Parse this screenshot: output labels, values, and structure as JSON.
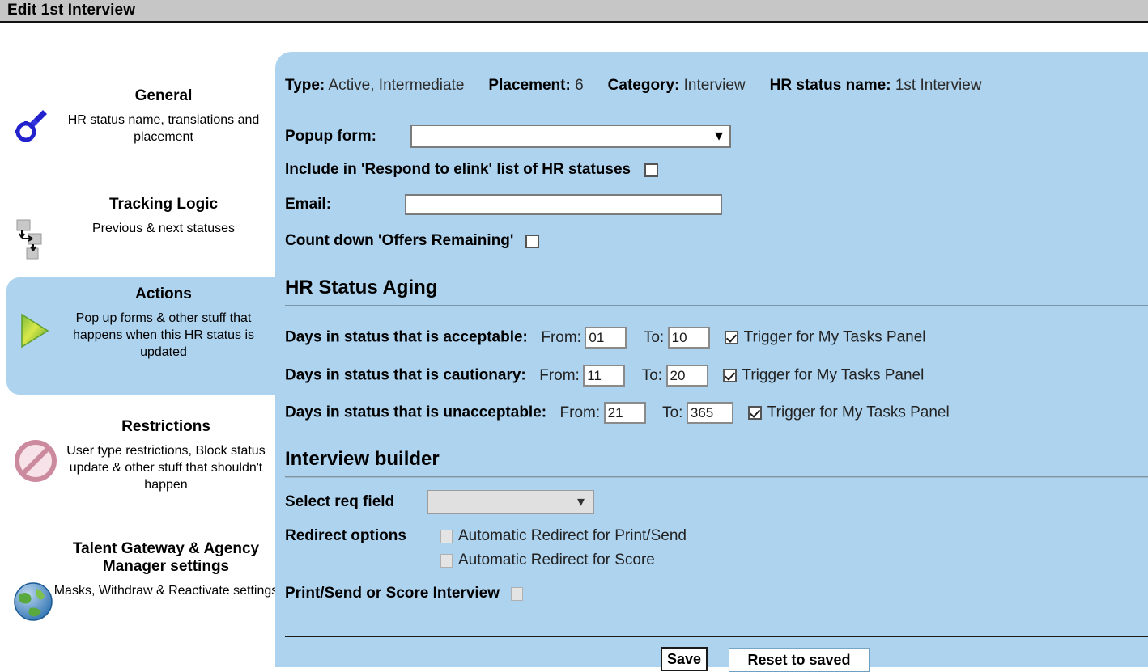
{
  "window": {
    "title": "Edit 1st Interview"
  },
  "sidebar": {
    "items": [
      {
        "key": "general",
        "icon": "wrench-gear-icon",
        "title": "General",
        "desc": "HR status name, translations and placement",
        "selected": false
      },
      {
        "key": "tracking-logic",
        "icon": "flowchart-icon",
        "title": "Tracking Logic",
        "desc": "Previous & next statuses",
        "selected": false
      },
      {
        "key": "actions",
        "icon": "green-play-arrow-icon",
        "title": "Actions",
        "desc": "Pop up forms & other stuff that happens when this HR status is updated",
        "selected": true
      },
      {
        "key": "restrictions",
        "icon": "no-entry-icon",
        "title": "Restrictions",
        "desc": "User type restrictions, Block status update & other stuff that shouldn't happen",
        "selected": false
      },
      {
        "key": "talent-gateway",
        "icon": "globe-icon",
        "title": "Talent Gateway & Agency Manager settings",
        "desc": "Masks, Withdraw & Reactivate settings",
        "selected": false
      }
    ]
  },
  "summary": {
    "type_label": "Type:",
    "type_value": "Active, Intermediate",
    "placement_label": "Placement:",
    "placement_value": "6",
    "category_label": "Category:",
    "category_value": "Interview",
    "hr_status_name_label": "HR status name:",
    "hr_status_name_value": "1st Interview"
  },
  "form": {
    "popup_form_label": "Popup form:",
    "popup_form_value": "",
    "popup_form_options": [
      ""
    ],
    "include_elink_label": "Include in 'Respond to elink' list of HR statuses",
    "include_elink_checked": false,
    "email_label": "Email:",
    "email_value": "",
    "email_placeholder": "",
    "count_down_label": "Count down 'Offers Remaining'",
    "count_down_checked": false
  },
  "aging": {
    "heading": "HR Status Aging",
    "from_label": "From:",
    "to_label": "To:",
    "trigger_label": "Trigger for My Tasks Panel",
    "rows": [
      {
        "label": "Days in status that is acceptable:",
        "from": "01",
        "to": "10",
        "trigger_checked": true
      },
      {
        "label": "Days in status that is cautionary:",
        "from": "11",
        "to": "20",
        "trigger_checked": true
      },
      {
        "label": "Days in status that is unacceptable:",
        "from": "21",
        "to": "365",
        "trigger_checked": true
      }
    ]
  },
  "builder": {
    "heading": "Interview builder",
    "select_req_field_label": "Select req field",
    "select_req_field_value": "",
    "select_req_field_options": [
      ""
    ],
    "redirect_options_label": "Redirect options",
    "redirect_print_send_label": "Automatic Redirect for Print/Send",
    "redirect_print_send_checked": false,
    "redirect_score_label": "Automatic Redirect for Score",
    "redirect_score_checked": false,
    "print_send_or_score_label": "Print/Send or Score Interview",
    "print_send_or_score_checked": false
  },
  "footer": {
    "save_label": "Save",
    "reset_label": "Reset to saved"
  },
  "colors": {
    "panel_background": "#aed3ef",
    "titlebar_background": "#c6c6c6",
    "page_background": "#ffffff",
    "accent_green": "#8cc63f",
    "divider": "#9fb7c9"
  }
}
